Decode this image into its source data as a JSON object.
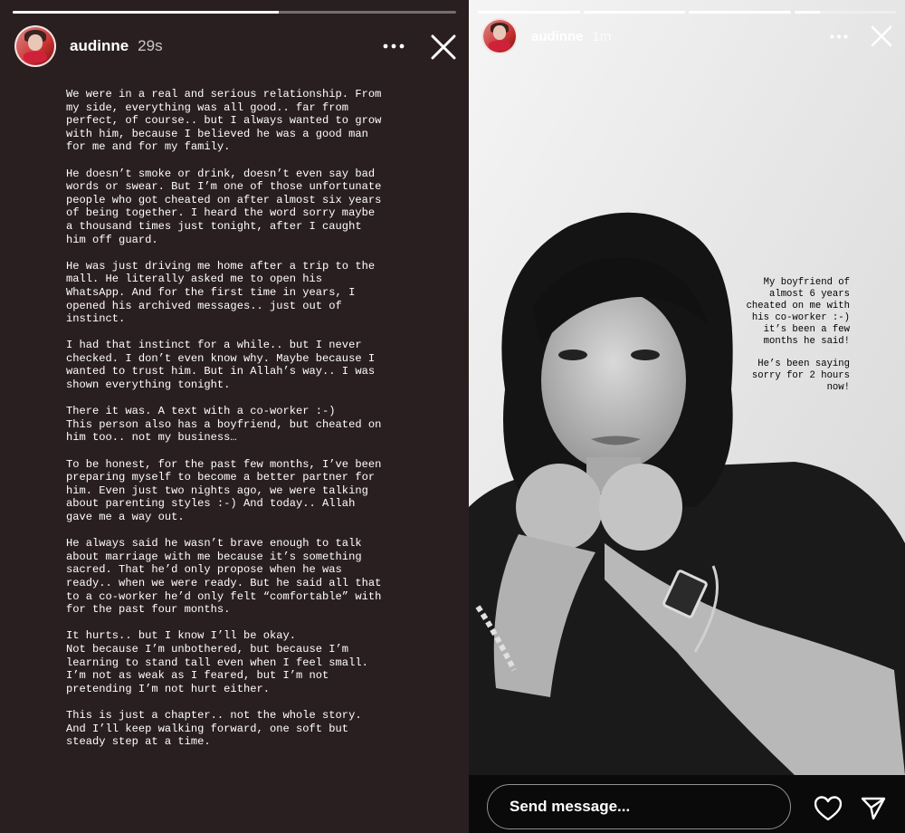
{
  "left_story": {
    "username": "audinne",
    "time": "29s",
    "progress": [
      0.6
    ],
    "paragraphs": [
      "We were in a real and serious relationship. From\nmy side, everything was all good.. far from\nperfect, of course.. but I always wanted to grow\nwith him, because I believed he was a good man\nfor me and for my family.",
      "He doesn’t smoke or drink, doesn’t even say bad\nwords or swear. But I’m one of those unfortunate\npeople who got cheated on after almost six years\nof being together. I heard the word sorry maybe\na thousand times just tonight, after I caught\nhim off guard.",
      "He was just driving me home after a trip to the\nmall. He literally asked me to open his\nWhatsApp. And for the first time in years, I\nopened his archived messages.. just out of\ninstinct.",
      "I had that instinct for a while.. but I never\nchecked. I don’t even know why. Maybe because I\nwanted to trust him. But in Allah’s way.. I was\nshown everything tonight.",
      "There it was. A text with a co-worker :-)\nThis person also has a boyfriend, but cheated on\nhim too.. not my business…",
      "To be honest, for the past few months, I’ve been\npreparing myself to become a better partner for\nhim. Even just two nights ago, we were talking\nabout parenting styles :-) And today.. Allah\ngave me a way out.",
      "He always said he wasn’t brave enough to talk\nabout marriage with me because it’s something\nsacred. That he’d only propose when he was\nready.. when we were ready. But he said all that\nto a co-worker he’d only felt “comfortable” with\nfor the past four months.",
      "It hurts.. but I know I’ll be okay.\nNot because I’m unbothered, but because I’m\nlearning to stand tall even when I feel small.\nI’m not as weak as I feared, but I’m not\npretending I’m not hurt either.",
      "This is just a chapter.. not the whole story.\nAnd I’ll keep walking forward, one soft but\nsteady step at a time."
    ]
  },
  "right_story": {
    "username": "audinne",
    "time": "1m",
    "progress": [
      1,
      1,
      1,
      0.25
    ],
    "caption": [
      "My boyfriend of\nalmost 6 years\ncheated on me with\nhis co-worker :-)\nit’s been a few\nmonths he said!",
      "He’s been saying\nsorry for 2 hours\nnow!"
    ],
    "reply_placeholder": "Send message..."
  },
  "icons": {
    "more": "more-horizontal-icon",
    "close": "close-icon",
    "like": "heart-icon",
    "share": "paper-plane-icon"
  },
  "colors": {
    "text_story_background": "#2a1f20",
    "text_color": "#ffffff"
  }
}
